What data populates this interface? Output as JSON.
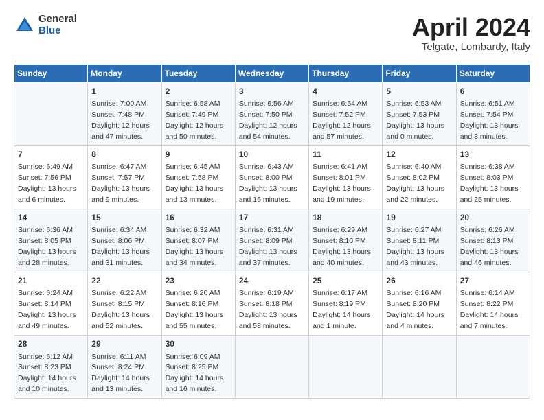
{
  "header": {
    "logo_general": "General",
    "logo_blue": "Blue",
    "title": "April 2024",
    "location": "Telgate, Lombardy, Italy"
  },
  "weekdays": [
    "Sunday",
    "Monday",
    "Tuesday",
    "Wednesday",
    "Thursday",
    "Friday",
    "Saturday"
  ],
  "weeks": [
    [
      {
        "day": "",
        "info": ""
      },
      {
        "day": "1",
        "info": "Sunrise: 7:00 AM\nSunset: 7:48 PM\nDaylight: 12 hours\nand 47 minutes."
      },
      {
        "day": "2",
        "info": "Sunrise: 6:58 AM\nSunset: 7:49 PM\nDaylight: 12 hours\nand 50 minutes."
      },
      {
        "day": "3",
        "info": "Sunrise: 6:56 AM\nSunset: 7:50 PM\nDaylight: 12 hours\nand 54 minutes."
      },
      {
        "day": "4",
        "info": "Sunrise: 6:54 AM\nSunset: 7:52 PM\nDaylight: 12 hours\nand 57 minutes."
      },
      {
        "day": "5",
        "info": "Sunrise: 6:53 AM\nSunset: 7:53 PM\nDaylight: 13 hours\nand 0 minutes."
      },
      {
        "day": "6",
        "info": "Sunrise: 6:51 AM\nSunset: 7:54 PM\nDaylight: 13 hours\nand 3 minutes."
      }
    ],
    [
      {
        "day": "7",
        "info": "Sunrise: 6:49 AM\nSunset: 7:56 PM\nDaylight: 13 hours\nand 6 minutes."
      },
      {
        "day": "8",
        "info": "Sunrise: 6:47 AM\nSunset: 7:57 PM\nDaylight: 13 hours\nand 9 minutes."
      },
      {
        "day": "9",
        "info": "Sunrise: 6:45 AM\nSunset: 7:58 PM\nDaylight: 13 hours\nand 13 minutes."
      },
      {
        "day": "10",
        "info": "Sunrise: 6:43 AM\nSunset: 8:00 PM\nDaylight: 13 hours\nand 16 minutes."
      },
      {
        "day": "11",
        "info": "Sunrise: 6:41 AM\nSunset: 8:01 PM\nDaylight: 13 hours\nand 19 minutes."
      },
      {
        "day": "12",
        "info": "Sunrise: 6:40 AM\nSunset: 8:02 PM\nDaylight: 13 hours\nand 22 minutes."
      },
      {
        "day": "13",
        "info": "Sunrise: 6:38 AM\nSunset: 8:03 PM\nDaylight: 13 hours\nand 25 minutes."
      }
    ],
    [
      {
        "day": "14",
        "info": "Sunrise: 6:36 AM\nSunset: 8:05 PM\nDaylight: 13 hours\nand 28 minutes."
      },
      {
        "day": "15",
        "info": "Sunrise: 6:34 AM\nSunset: 8:06 PM\nDaylight: 13 hours\nand 31 minutes."
      },
      {
        "day": "16",
        "info": "Sunrise: 6:32 AM\nSunset: 8:07 PM\nDaylight: 13 hours\nand 34 minutes."
      },
      {
        "day": "17",
        "info": "Sunrise: 6:31 AM\nSunset: 8:09 PM\nDaylight: 13 hours\nand 37 minutes."
      },
      {
        "day": "18",
        "info": "Sunrise: 6:29 AM\nSunset: 8:10 PM\nDaylight: 13 hours\nand 40 minutes."
      },
      {
        "day": "19",
        "info": "Sunrise: 6:27 AM\nSunset: 8:11 PM\nDaylight: 13 hours\nand 43 minutes."
      },
      {
        "day": "20",
        "info": "Sunrise: 6:26 AM\nSunset: 8:13 PM\nDaylight: 13 hours\nand 46 minutes."
      }
    ],
    [
      {
        "day": "21",
        "info": "Sunrise: 6:24 AM\nSunset: 8:14 PM\nDaylight: 13 hours\nand 49 minutes."
      },
      {
        "day": "22",
        "info": "Sunrise: 6:22 AM\nSunset: 8:15 PM\nDaylight: 13 hours\nand 52 minutes."
      },
      {
        "day": "23",
        "info": "Sunrise: 6:20 AM\nSunset: 8:16 PM\nDaylight: 13 hours\nand 55 minutes."
      },
      {
        "day": "24",
        "info": "Sunrise: 6:19 AM\nSunset: 8:18 PM\nDaylight: 13 hours\nand 58 minutes."
      },
      {
        "day": "25",
        "info": "Sunrise: 6:17 AM\nSunset: 8:19 PM\nDaylight: 14 hours\nand 1 minute."
      },
      {
        "day": "26",
        "info": "Sunrise: 6:16 AM\nSunset: 8:20 PM\nDaylight: 14 hours\nand 4 minutes."
      },
      {
        "day": "27",
        "info": "Sunrise: 6:14 AM\nSunset: 8:22 PM\nDaylight: 14 hours\nand 7 minutes."
      }
    ],
    [
      {
        "day": "28",
        "info": "Sunrise: 6:12 AM\nSunset: 8:23 PM\nDaylight: 14 hours\nand 10 minutes."
      },
      {
        "day": "29",
        "info": "Sunrise: 6:11 AM\nSunset: 8:24 PM\nDaylight: 14 hours\nand 13 minutes."
      },
      {
        "day": "30",
        "info": "Sunrise: 6:09 AM\nSunset: 8:25 PM\nDaylight: 14 hours\nand 16 minutes."
      },
      {
        "day": "",
        "info": ""
      },
      {
        "day": "",
        "info": ""
      },
      {
        "day": "",
        "info": ""
      },
      {
        "day": "",
        "info": ""
      }
    ]
  ]
}
